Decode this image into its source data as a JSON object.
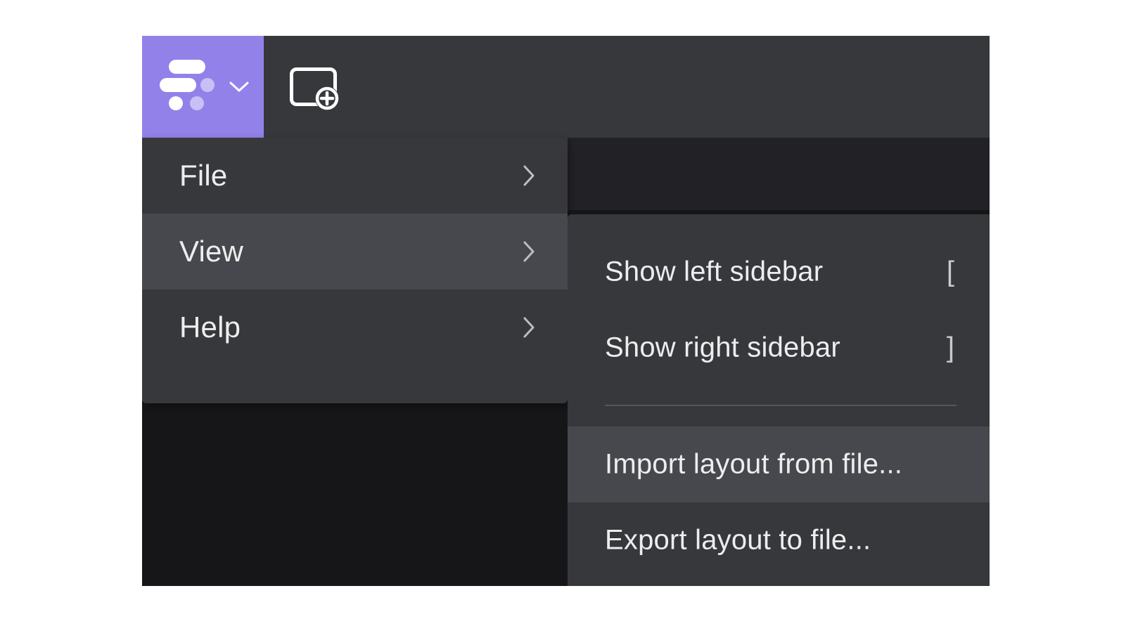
{
  "colors": {
    "accent": "#9381ea",
    "toolbar_bg": "#37383c",
    "menu_bg": "#37383c",
    "menu_highlight": "#47484d",
    "workspace_bg": "#161619",
    "text": "#ededee"
  },
  "toolbar": {
    "logo_icon": "app-logo-icon",
    "logo_dropdown_icon": "chevron-down-icon",
    "new_panel_icon": "add-panel-icon"
  },
  "menu": {
    "items": [
      {
        "label": "File",
        "icon": "chevron-right-icon",
        "active": false
      },
      {
        "label": "View",
        "icon": "chevron-right-icon",
        "active": true
      },
      {
        "label": "Help",
        "icon": "chevron-right-icon",
        "active": false
      }
    ]
  },
  "submenu": {
    "items": [
      {
        "label": "Show left sidebar",
        "shortcut": "["
      },
      {
        "label": "Show right sidebar",
        "shortcut": "]"
      },
      {
        "label": "Import layout from file...",
        "shortcut": ""
      },
      {
        "label": "Export layout to file...",
        "shortcut": ""
      }
    ],
    "highlighted": "Import layout from file..."
  }
}
